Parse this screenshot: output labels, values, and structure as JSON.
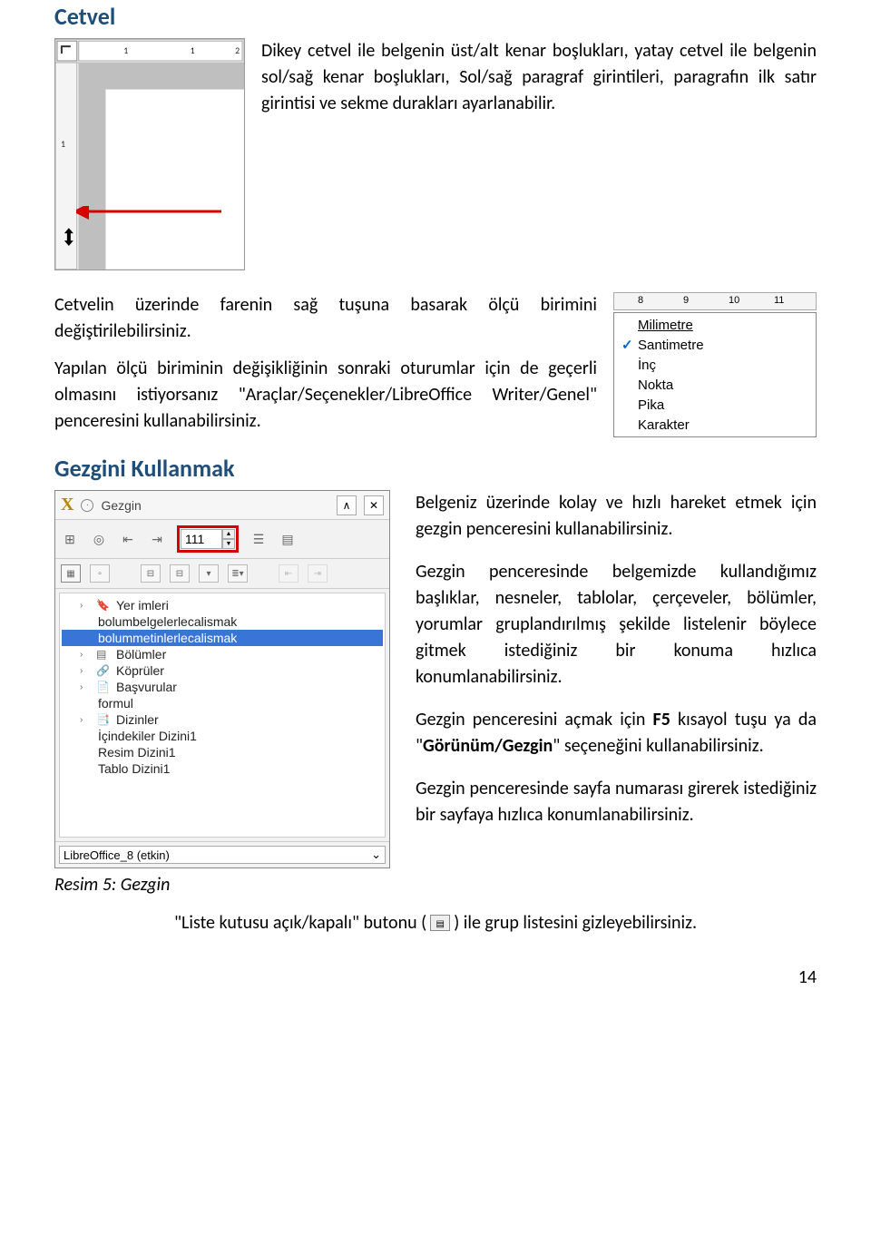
{
  "section1_title": "Cetvel",
  "para1": "Dikey cetvel ile belgenin üst/alt kenar boşlukları, yatay cetvel ile belgenin sol/sağ kenar boşlukları, Sol/sağ paragraf girintileri, paragrafın ilk satır girintisi ve sekme durakları ayarlanabilir.",
  "para2": "Cetvelin üzerinde farenin sağ tuşuna basarak ölçü birimini değiştirilebilirsiniz.",
  "para3": "Yapılan ölçü biriminin değişikliğinin sonraki oturumlar için de geçerli olmasını istiyorsanız \"Araçlar/Seçenekler/LibreOffice Writer/Genel\" penceresini kullanabilirsiniz.",
  "ruler_marks": {
    "a": "8",
    "b": "9",
    "c": "10",
    "d": "11"
  },
  "context_menu": {
    "items": [
      {
        "label": "Milimetre",
        "checked": false
      },
      {
        "label": "Santimetre",
        "checked": true
      },
      {
        "label": "İnç",
        "checked": false
      },
      {
        "label": "Nokta",
        "checked": false
      },
      {
        "label": "Pika",
        "checked": false
      },
      {
        "label": "Karakter",
        "checked": false
      }
    ]
  },
  "section2_title": "Gezgini Kullanmak",
  "gezgin_window": {
    "title": "Gezgin",
    "page_value": "111",
    "tree": [
      {
        "type": "node",
        "icon": "bookmark",
        "label": "Yer imleri",
        "indent": 1,
        "arrow": true
      },
      {
        "type": "leaf",
        "label": "bolumbelgelerlecalismak",
        "indent": 2
      },
      {
        "type": "leaf-sel",
        "label": "bolummetinlerlecalismak",
        "indent": 2
      },
      {
        "type": "node",
        "icon": "sections",
        "label": "Bölümler",
        "indent": 1,
        "arrow": true
      },
      {
        "type": "node",
        "icon": "link",
        "label": "Köprüler",
        "indent": 1,
        "arrow": true
      },
      {
        "type": "node",
        "icon": "ref",
        "label": "Başvurular",
        "indent": 1,
        "arrow": true
      },
      {
        "type": "leaf",
        "label": "formul",
        "indent": 2
      },
      {
        "type": "node",
        "icon": "index",
        "label": "Dizinler",
        "indent": 1,
        "arrow": true
      },
      {
        "type": "leaf",
        "label": "İçindekiler Dizini1",
        "indent": 2
      },
      {
        "type": "leaf",
        "label": "Resim Dizini1",
        "indent": 2
      },
      {
        "type": "leaf",
        "label": "Tablo Dizini1",
        "indent": 2
      }
    ],
    "combo": "LibreOffice_8 (etkin)"
  },
  "figure_caption": "Resim 5: Gezgin",
  "rp1": "Belgeniz üzerinde kolay ve hızlı hareket etmek için gezgin penceresini kullanabilirsiniz.",
  "rp2": "Gezgin penceresinde belgemizde kullandığımız başlıklar, nesneler, tablolar, çerçeveler, bölümler, yorumlar gruplandırılmış şekilde listelenir böylece gitmek istediğiniz bir konuma hızlıca konumlanabilirsiniz.",
  "rp3_pre": "Gezgin penceresini açmak için ",
  "rp3_bold1": "F5",
  "rp3_mid": " kısayol tuşu ya da \"",
  "rp3_bold2": "Görünüm/Gezgin",
  "rp3_post": "\" seçeneğini kullanabilirsiniz.",
  "rp4": "Gezgin penceresinde sayfa numarası girerek istediğiniz bir sayfaya hızlıca konumlanabilirsiniz.",
  "last_pre": "\"Liste kutusu açık/kapalı\" butonu (",
  "last_post": ") ile grup listesini gizleyebilirsiniz.",
  "page_number": "14"
}
